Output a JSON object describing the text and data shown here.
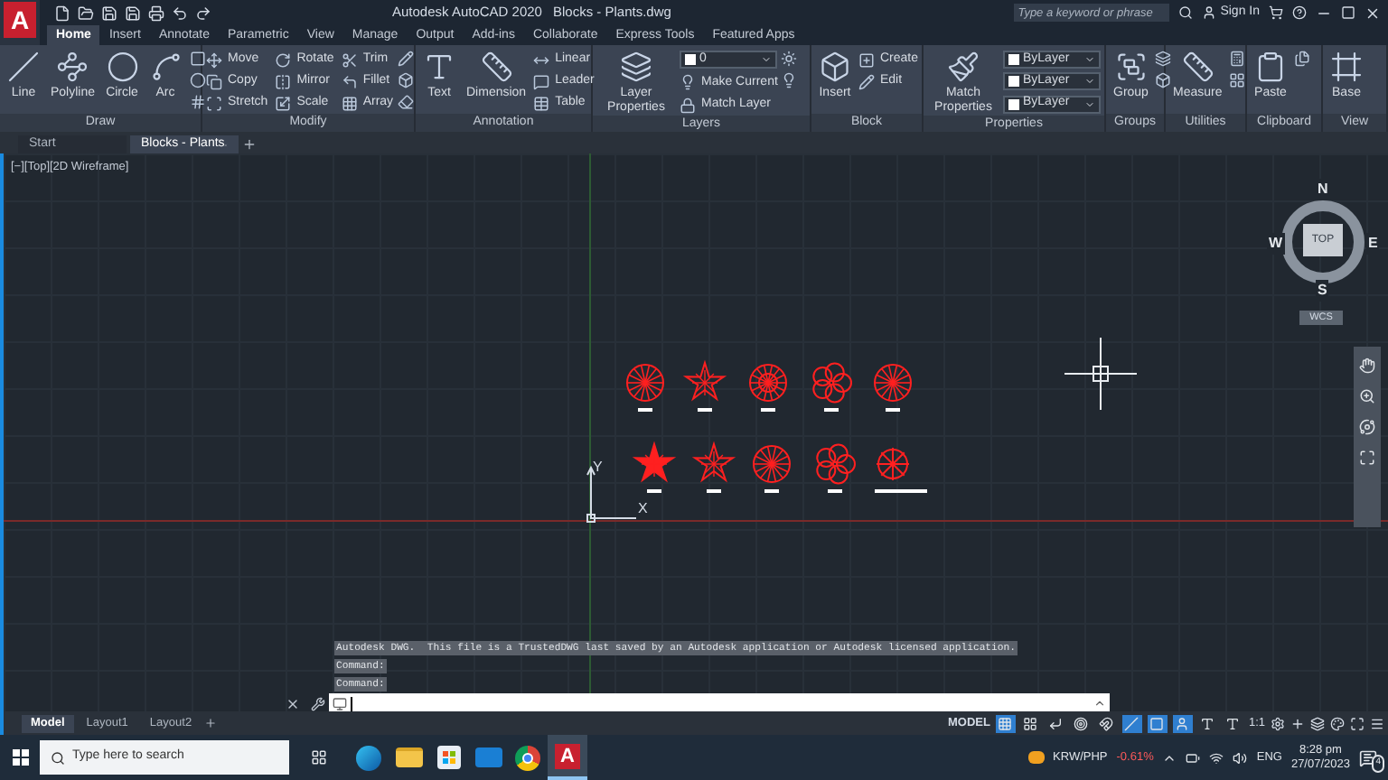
{
  "app": {
    "logo": "A",
    "title": "Autodesk AutoCAD 2020",
    "file": "Blocks - Plants.dwg",
    "search_placeholder": "Type a keyword or phrase",
    "sign_in": "Sign In"
  },
  "ribbon_tabs": [
    {
      "label": "Home",
      "selected": true
    },
    {
      "label": "Insert",
      "selected": false
    },
    {
      "label": "Annotate",
      "selected": false
    },
    {
      "label": "Parametric",
      "selected": false
    },
    {
      "label": "View",
      "selected": false
    },
    {
      "label": "Manage",
      "selected": false
    },
    {
      "label": "Output",
      "selected": false
    },
    {
      "label": "Add-ins",
      "selected": false
    },
    {
      "label": "Collaborate",
      "selected": false
    },
    {
      "label": "Express Tools",
      "selected": false
    },
    {
      "label": "Featured Apps",
      "selected": false
    }
  ],
  "panels": [
    {
      "title": "Draw",
      "tools": [
        {
          "kind": "big",
          "label": "Line"
        },
        {
          "kind": "big",
          "label": "Polyline"
        },
        {
          "kind": "big",
          "label": "Circle"
        },
        {
          "kind": "big",
          "label": "Arc"
        }
      ]
    },
    {
      "title": "Modify",
      "tools": [
        {
          "kind": "small",
          "label": "Move"
        },
        {
          "kind": "small",
          "label": "Copy"
        },
        {
          "kind": "small",
          "label": "Stretch"
        },
        {
          "kind": "small",
          "label": "Rotate"
        },
        {
          "kind": "small",
          "label": "Mirror"
        },
        {
          "kind": "small",
          "label": "Scale"
        },
        {
          "kind": "small",
          "label": "Trim"
        },
        {
          "kind": "small",
          "label": "Fillet"
        },
        {
          "kind": "small",
          "label": "Array"
        }
      ]
    },
    {
      "title": "Annotation",
      "tools": [
        {
          "kind": "big",
          "label": "Text"
        },
        {
          "kind": "big",
          "label": "Dimension"
        },
        {
          "kind": "small",
          "label": "Linear"
        },
        {
          "kind": "small",
          "label": "Leader"
        },
        {
          "kind": "small",
          "label": "Table"
        }
      ]
    },
    {
      "title": "Layers",
      "tools": [
        {
          "kind": "big",
          "label": "Layer Properties"
        },
        {
          "kind": "dropdown",
          "label": "0"
        },
        {
          "kind": "small",
          "label": "Make Current"
        },
        {
          "kind": "small",
          "label": "Match Layer"
        }
      ]
    },
    {
      "title": "Block",
      "tools": [
        {
          "kind": "big",
          "label": "Insert"
        },
        {
          "kind": "small",
          "label": "Create"
        },
        {
          "kind": "small",
          "label": "Edit"
        }
      ]
    },
    {
      "title": "Properties",
      "tools": [
        {
          "kind": "big",
          "label": "Match Properties"
        },
        {
          "kind": "dropdown",
          "label": "ByLayer"
        },
        {
          "kind": "dropdown",
          "label": "ByLayer"
        },
        {
          "kind": "dropdown",
          "label": "ByLayer"
        }
      ]
    },
    {
      "title": "Groups",
      "tools": [
        {
          "kind": "big",
          "label": "Group"
        }
      ]
    },
    {
      "title": "Utilities",
      "tools": [
        {
          "kind": "big",
          "label": "Measure"
        }
      ]
    },
    {
      "title": "Clipboard",
      "tools": [
        {
          "kind": "big",
          "label": "Paste"
        }
      ]
    },
    {
      "title": "View",
      "tools": [
        {
          "kind": "big",
          "label": "Base"
        }
      ]
    }
  ],
  "doc_tabs": [
    {
      "label": "Start",
      "selected": false
    },
    {
      "label": "Blocks - Plants",
      "selected": true
    }
  ],
  "viewport": {
    "label": "[−][Top][2D Wireframe]",
    "viewcube": {
      "north": "N",
      "south": "S",
      "east": "E",
      "west": "W",
      "face": "TOP",
      "coords": "WCS"
    },
    "ucs": {
      "x": "X",
      "y": "Y"
    }
  },
  "command": {
    "history": [
      "Autodesk DWG.  This file is a TrustedDWG last saved by an Autodesk application or Autodesk licensed application.",
      "Command:",
      "Command:"
    ]
  },
  "layout_tabs": [
    {
      "label": "Model",
      "selected": true
    },
    {
      "label": "Layout1",
      "selected": false
    },
    {
      "label": "Layout2",
      "selected": false
    }
  ],
  "status_bar": {
    "mode": "MODEL",
    "scale": "1:1",
    "toggles": [
      {
        "on": true
      },
      {
        "on": false
      },
      {
        "on": false
      },
      {
        "on": false
      },
      {
        "on": false
      },
      {
        "on": true
      },
      {
        "on": true
      },
      {
        "on": true
      },
      {
        "on": false
      },
      {
        "on": false
      }
    ]
  },
  "taskbar": {
    "search_placeholder": "Type here to search",
    "apps": [
      {
        "kind": "browser",
        "selected": false
      },
      {
        "kind": "folder",
        "selected": false
      },
      {
        "kind": "store",
        "selected": false
      },
      {
        "kind": "mail",
        "selected": false
      },
      {
        "kind": "chrome",
        "selected": false
      },
      {
        "kind": "cad",
        "selected": true
      }
    ],
    "app_logo": "A",
    "ticker": "KRW/PHP",
    "change": "-0.61%",
    "language": "ENG",
    "time": "8:28 pm",
    "date": "27/07/2023",
    "notifications": "4"
  }
}
